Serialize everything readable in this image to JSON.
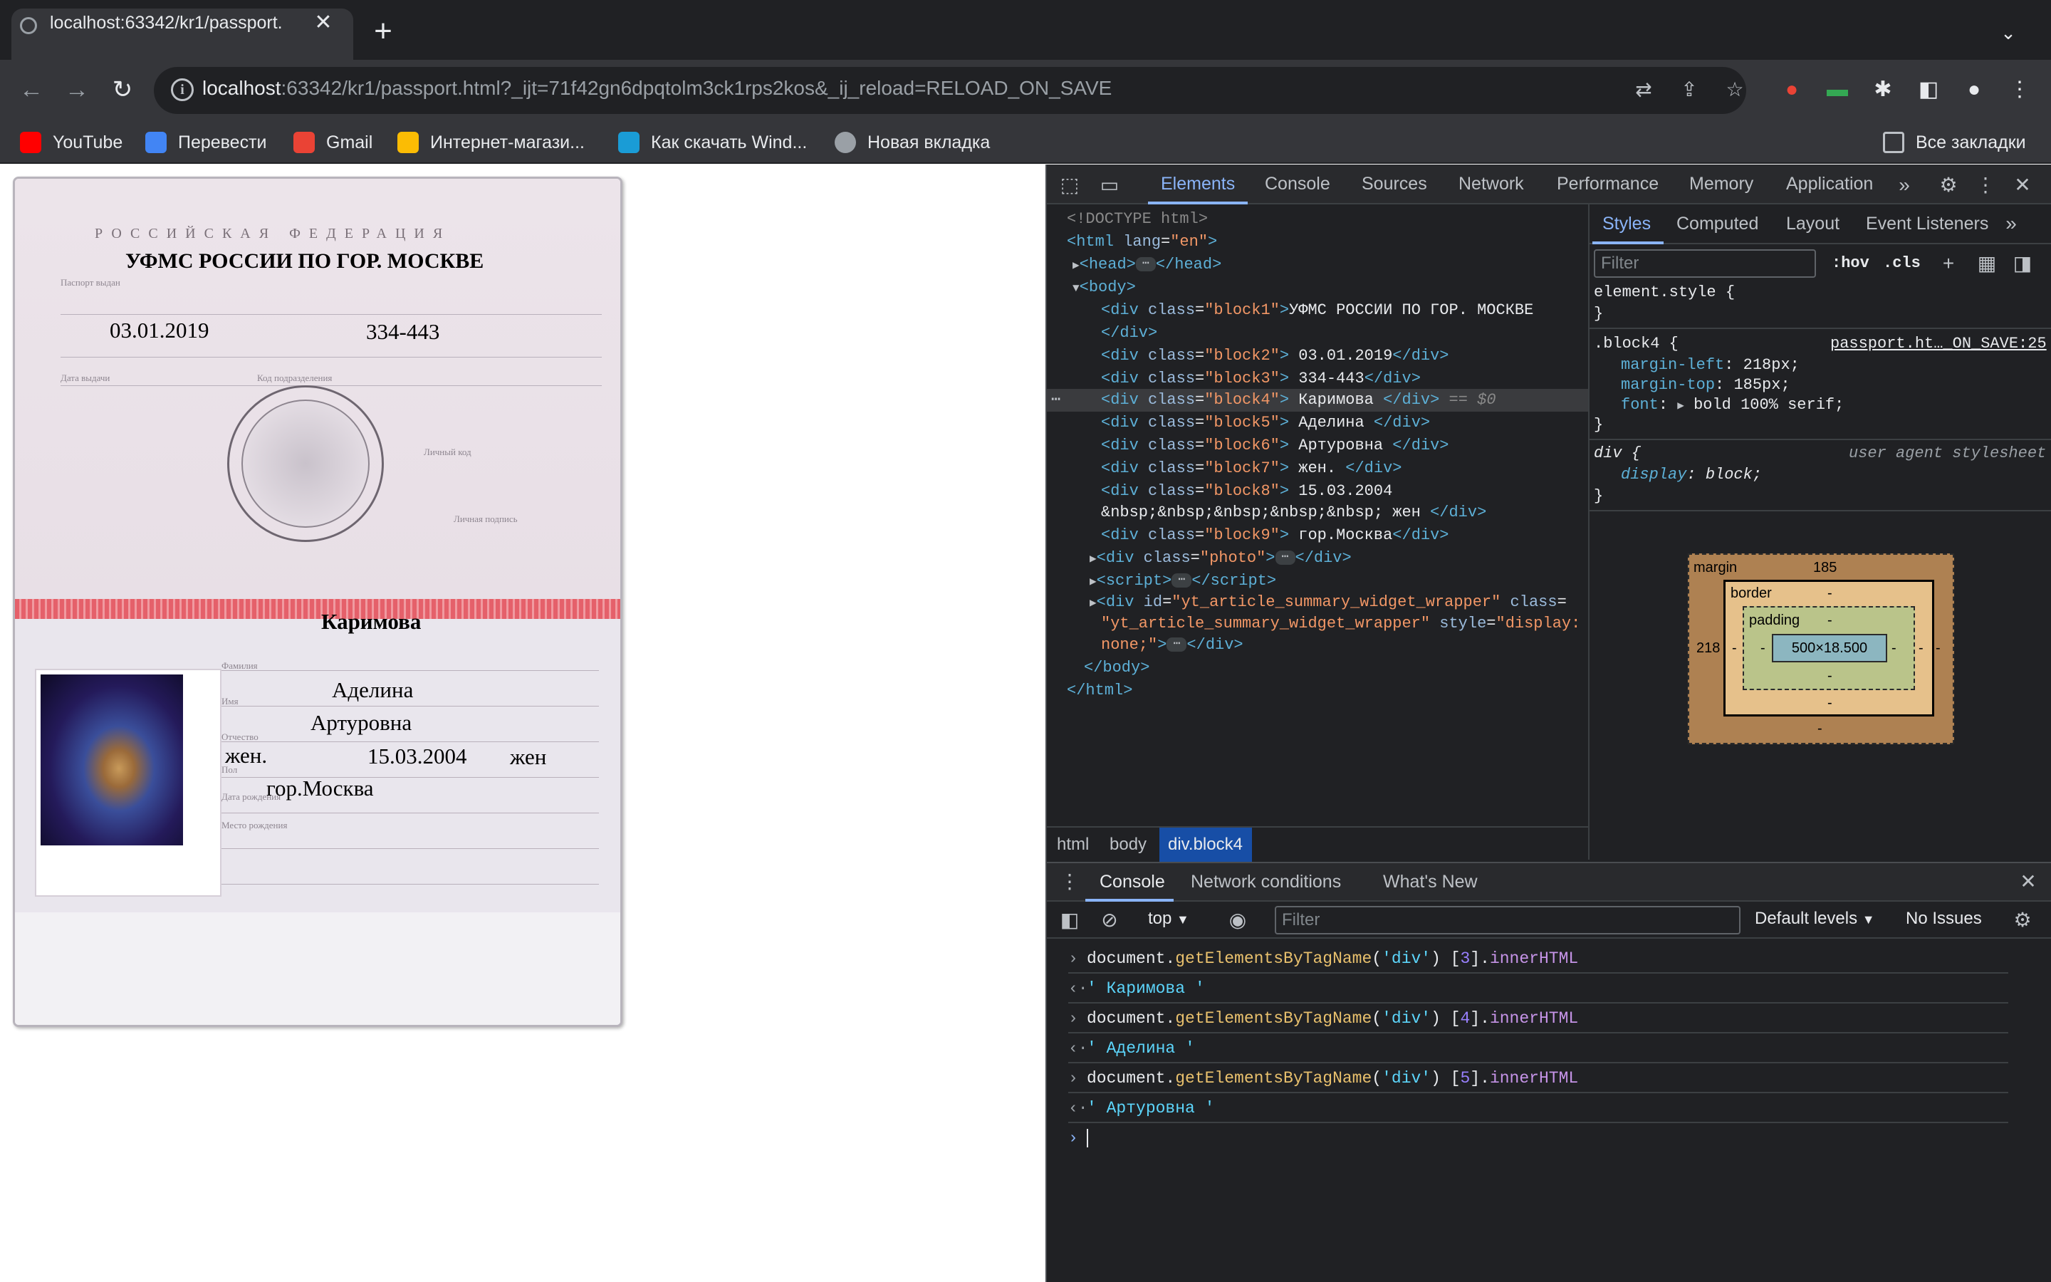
{
  "browser": {
    "tab_title": "localhost:63342/kr1/passport.",
    "url_host": "localhost",
    "url_rest": ":63342/kr1/passport.html?_ijt=71f42gn6dpqtolm3ck1rps2kos&_ij_reload=RELOAD_ON_SAVE",
    "bookmarks": [
      "YouTube",
      "Перевести",
      "Gmail",
      "Интернет-магази...",
      "Как скачать Wind...",
      "Новая вкладка"
    ],
    "all_bookmarks": "Все закладки",
    "colors": {
      "chrome_dark": "#202124",
      "chrome_toolbar": "#35363a",
      "devtools_accent": "#8ab4f8"
    }
  },
  "passport": {
    "header_country": "РОССИЙСКАЯ ФЕДЕРАЦИЯ",
    "issued_by_label": "Паспорт выдан",
    "issued_by": "УФМС РОССИИ ПО ГОР. МОСКВЕ",
    "issue_date": "03.01.2019",
    "dept_code": "334-443",
    "date_label": "Дата выдачи",
    "code_label": "Код подразделения",
    "sign_label": "Личный код",
    "sign2_label": "Личная подпись",
    "surname": "Каримова",
    "surname_label": "Фамилия",
    "name": "Аделина",
    "name_label": "Имя",
    "patronymic": "Артуровна",
    "patronymic_label": "Отчество",
    "sex": "жен.",
    "sex_label": "Пол",
    "birth_date": "15.03.2004",
    "birth_sex": "жен",
    "birth_date_label": "Дата рождения",
    "birthplace": "гор.Москва",
    "birthplace_label": "Место рождения"
  },
  "devtools": {
    "tabs": [
      "Elements",
      "Console",
      "Sources",
      "Network",
      "Performance",
      "Memory",
      "Application"
    ],
    "active_tab": "Elements",
    "dom": {
      "doctype": "<!DOCTYPE html>",
      "html_open": "html",
      "lang_attr": "lang",
      "lang_val": "\"en\"",
      "head": "head",
      "body": "body",
      "blocks": [
        {
          "cls": "\"block1\"",
          "text": "УФМС РОССИИ ПО ГОР. МОСКВЕ"
        },
        {
          "cls": "\"block2\"",
          "text": " 03.01.2019"
        },
        {
          "cls": "\"block3\"",
          "text": " 334-443"
        },
        {
          "cls": "\"block4\"",
          "text": " Каримова "
        },
        {
          "cls": "\"block5\"",
          "text": " Аделина "
        },
        {
          "cls": "\"block6\"",
          "text": " Артуровна "
        },
        {
          "cls": "\"block7\"",
          "text": " жен. "
        },
        {
          "cls": "\"block8\"",
          "text": " 15.03.2004"
        },
        {
          "cls": "\"block9\"",
          "text": " гор.Москва"
        }
      ],
      "block8_cont": "&nbsp;&nbsp;&nbsp;&nbsp;&nbsp; жен ",
      "selected_marker": "== $0",
      "photo_cls": "\"photo\"",
      "script": "script",
      "wrapper_id": "\"yt_article_summary_widget_wrapper\"",
      "wrapper_cls": "\"yt_article_summary_widget_wrapper\"",
      "wrapper_style": "\"display:",
      "wrapper_style2": "none;\""
    },
    "styles_tabs": [
      "Styles",
      "Computed",
      "Layout",
      "Event Listeners"
    ],
    "styles_filter": "Filter",
    "hov": ":hov",
    "cls": ".cls",
    "element_style": "element.style {",
    "close_brace": "}",
    "rule_selector": ".block4 {",
    "rule_source": "passport.ht…_ON_SAVE:25",
    "rule_props": [
      {
        "name": "margin-left",
        "value": "218px;"
      },
      {
        "name": "margin-top",
        "value": "185px;"
      },
      {
        "name": "font",
        "value": "bold 100% serif;"
      }
    ],
    "ua_selector": "div {",
    "ua_source": "user agent stylesheet",
    "ua_prop": {
      "name": "display",
      "value": "block;"
    },
    "box_model": {
      "margin_label": "margin",
      "margin_top": "185",
      "margin_left": "218",
      "margin_right": "-",
      "margin_bottom": "-",
      "border_label": "border",
      "border_val": "-",
      "padding_label": "padding",
      "padding_val": "-",
      "content": "500×18.500"
    },
    "breadcrumbs": [
      "html",
      "body",
      "div.block4"
    ],
    "drawer_tabs": [
      "Console",
      "Network conditions",
      "What's New"
    ],
    "console_context": "top",
    "console_filter": "Filter",
    "levels": "Default levels",
    "issues": "No Issues",
    "console": [
      {
        "type": "in",
        "obj": "document",
        "fn": "getElementsByTagName",
        "arg": "'div'",
        "idx": "3",
        "prop": "innerHTML"
      },
      {
        "type": "out",
        "value": "' Каримова '"
      },
      {
        "type": "in",
        "obj": "document",
        "fn": "getElementsByTagName",
        "arg": "'div'",
        "idx": "4",
        "prop": "innerHTML"
      },
      {
        "type": "out",
        "value": "' Аделина '"
      },
      {
        "type": "in",
        "obj": "document",
        "fn": "getElementsByTagName",
        "arg": "'div'",
        "idx": "5",
        "prop": "innerHTML"
      },
      {
        "type": "out",
        "value": "' Артуровна '"
      }
    ]
  }
}
